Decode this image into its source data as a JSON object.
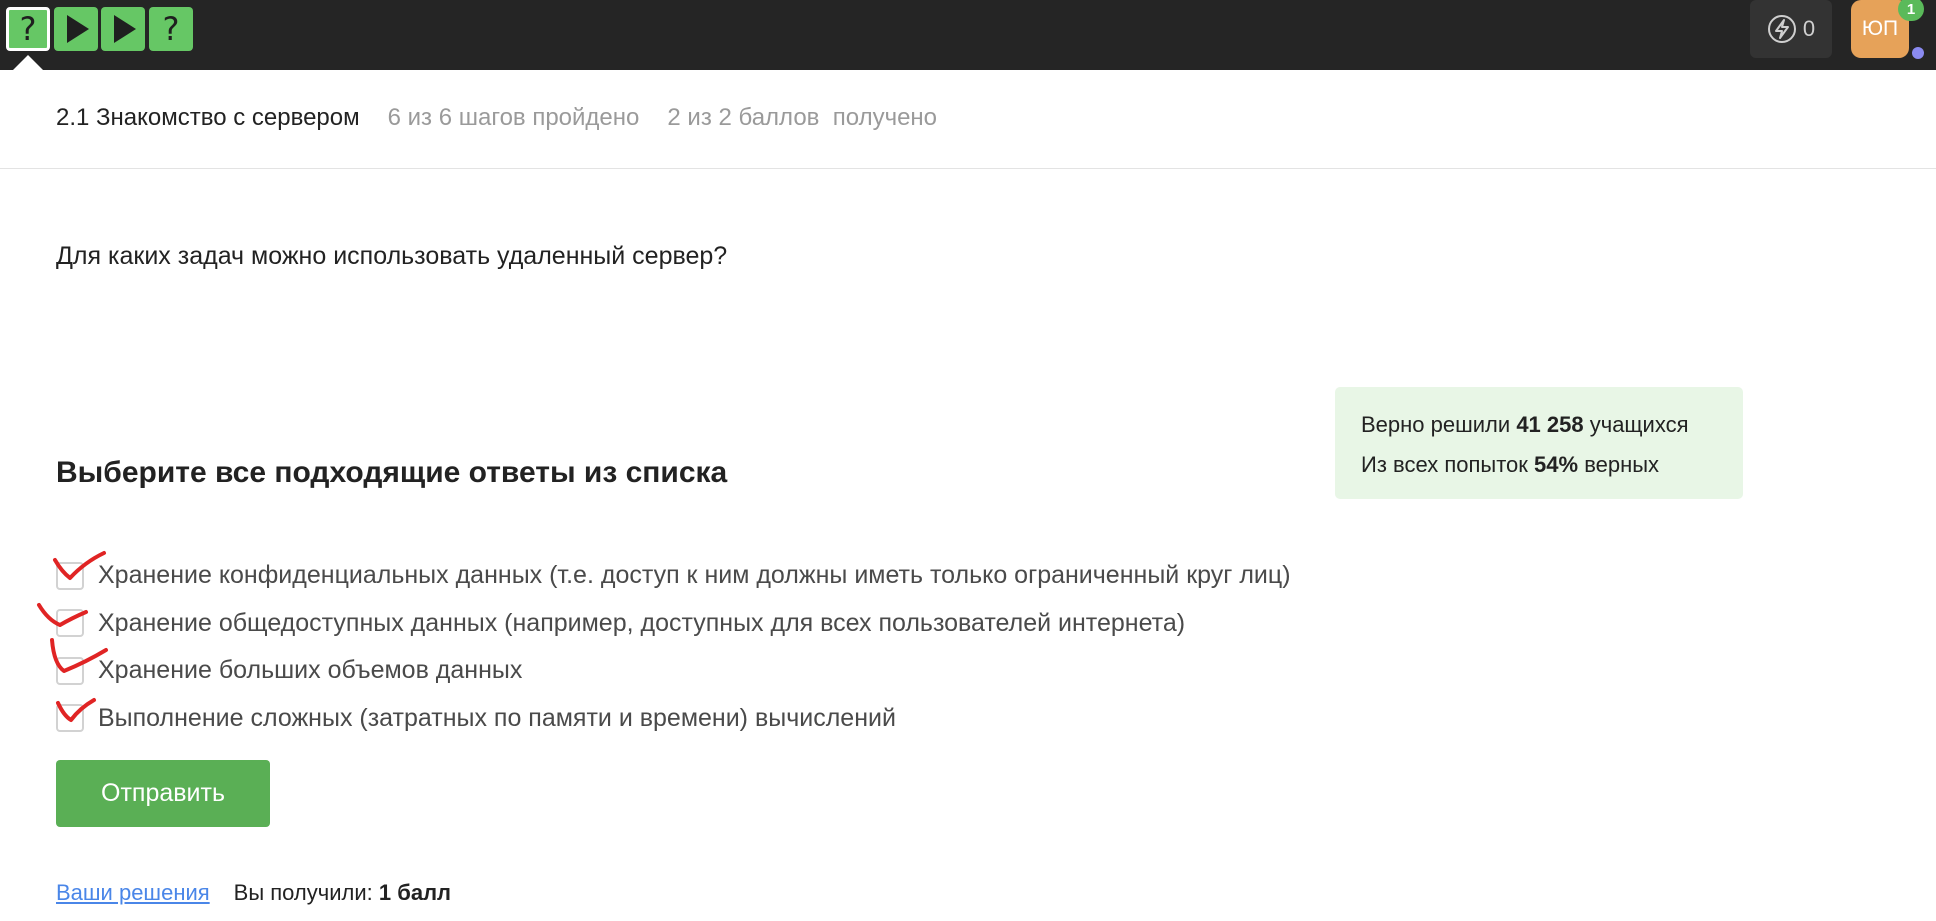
{
  "topbar": {
    "steps": [
      {
        "type": "question",
        "glyph": "?",
        "active": true
      },
      {
        "type": "video",
        "glyph": "play",
        "active": false
      },
      {
        "type": "video",
        "glyph": "play",
        "active": false
      },
      {
        "type": "question",
        "glyph": "?",
        "active": false
      }
    ],
    "energy_count": "0",
    "avatar_initials": "ЮП",
    "notification_count": "1",
    "accent_color": "#66c765"
  },
  "lesson": {
    "title": "2.1 Знакомство с сервером",
    "steps_progress": "6 из 6 шагов пройдено",
    "points_progress": "2 из 2 баллов  получено"
  },
  "question": {
    "text": "Для каких задач можно использовать удаленный сервер?"
  },
  "stats": {
    "solved_prefix": "Верно решили",
    "solved_count": "41 258",
    "solved_suffix": "учащихся",
    "attempts_prefix": "Из всех попыток",
    "attempts_percent": "54%",
    "attempts_suffix": "верных"
  },
  "instruction": "Выберите все подходящие ответы из списка",
  "options": [
    {
      "label": "Хранение конфиденциальных данных (т.е. доступ к ним должны иметь только ограниченный круг лиц)",
      "handwritten_mark": "check"
    },
    {
      "label": "Хранение общедоступных данных (например, доступных для всех пользователей интернета)",
      "handwritten_mark": "check"
    },
    {
      "label": "Хранение больших объемов данных",
      "handwritten_mark": "check"
    },
    {
      "label": "Выполнение сложных (затратных по памяти и времени) вычислений",
      "handwritten_mark": "check"
    }
  ],
  "submit_label": "Отправить",
  "footer": {
    "solutions_link": "Ваши решения",
    "score_prefix": "Вы получили:",
    "score_value": "1 балл"
  }
}
